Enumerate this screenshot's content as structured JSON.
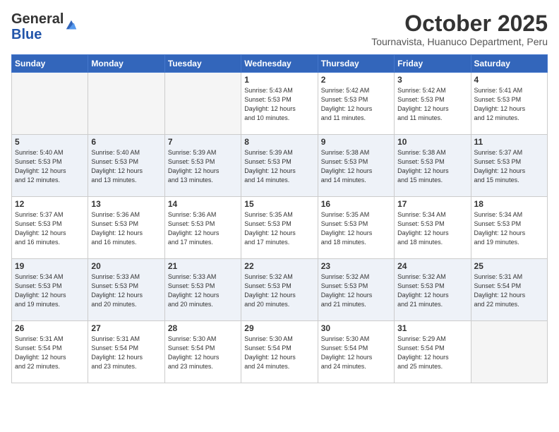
{
  "header": {
    "logo_general": "General",
    "logo_blue": "Blue",
    "month_title": "October 2025",
    "location": "Tournavista, Huanuco Department, Peru"
  },
  "days": [
    "Sunday",
    "Monday",
    "Tuesday",
    "Wednesday",
    "Thursday",
    "Friday",
    "Saturday"
  ],
  "weeks": [
    {
      "cells": [
        {
          "day": "",
          "info": ""
        },
        {
          "day": "",
          "info": ""
        },
        {
          "day": "",
          "info": ""
        },
        {
          "day": "1",
          "info": "Sunrise: 5:43 AM\nSunset: 5:53 PM\nDaylight: 12 hours\nand 10 minutes."
        },
        {
          "day": "2",
          "info": "Sunrise: 5:42 AM\nSunset: 5:53 PM\nDaylight: 12 hours\nand 11 minutes."
        },
        {
          "day": "3",
          "info": "Sunrise: 5:42 AM\nSunset: 5:53 PM\nDaylight: 12 hours\nand 11 minutes."
        },
        {
          "day": "4",
          "info": "Sunrise: 5:41 AM\nSunset: 5:53 PM\nDaylight: 12 hours\nand 12 minutes."
        }
      ]
    },
    {
      "cells": [
        {
          "day": "5",
          "info": "Sunrise: 5:40 AM\nSunset: 5:53 PM\nDaylight: 12 hours\nand 12 minutes."
        },
        {
          "day": "6",
          "info": "Sunrise: 5:40 AM\nSunset: 5:53 PM\nDaylight: 12 hours\nand 13 minutes."
        },
        {
          "day": "7",
          "info": "Sunrise: 5:39 AM\nSunset: 5:53 PM\nDaylight: 12 hours\nand 13 minutes."
        },
        {
          "day": "8",
          "info": "Sunrise: 5:39 AM\nSunset: 5:53 PM\nDaylight: 12 hours\nand 14 minutes."
        },
        {
          "day": "9",
          "info": "Sunrise: 5:38 AM\nSunset: 5:53 PM\nDaylight: 12 hours\nand 14 minutes."
        },
        {
          "day": "10",
          "info": "Sunrise: 5:38 AM\nSunset: 5:53 PM\nDaylight: 12 hours\nand 15 minutes."
        },
        {
          "day": "11",
          "info": "Sunrise: 5:37 AM\nSunset: 5:53 PM\nDaylight: 12 hours\nand 15 minutes."
        }
      ]
    },
    {
      "cells": [
        {
          "day": "12",
          "info": "Sunrise: 5:37 AM\nSunset: 5:53 PM\nDaylight: 12 hours\nand 16 minutes."
        },
        {
          "day": "13",
          "info": "Sunrise: 5:36 AM\nSunset: 5:53 PM\nDaylight: 12 hours\nand 16 minutes."
        },
        {
          "day": "14",
          "info": "Sunrise: 5:36 AM\nSunset: 5:53 PM\nDaylight: 12 hours\nand 17 minutes."
        },
        {
          "day": "15",
          "info": "Sunrise: 5:35 AM\nSunset: 5:53 PM\nDaylight: 12 hours\nand 17 minutes."
        },
        {
          "day": "16",
          "info": "Sunrise: 5:35 AM\nSunset: 5:53 PM\nDaylight: 12 hours\nand 18 minutes."
        },
        {
          "day": "17",
          "info": "Sunrise: 5:34 AM\nSunset: 5:53 PM\nDaylight: 12 hours\nand 18 minutes."
        },
        {
          "day": "18",
          "info": "Sunrise: 5:34 AM\nSunset: 5:53 PM\nDaylight: 12 hours\nand 19 minutes."
        }
      ]
    },
    {
      "cells": [
        {
          "day": "19",
          "info": "Sunrise: 5:34 AM\nSunset: 5:53 PM\nDaylight: 12 hours\nand 19 minutes."
        },
        {
          "day": "20",
          "info": "Sunrise: 5:33 AM\nSunset: 5:53 PM\nDaylight: 12 hours\nand 20 minutes."
        },
        {
          "day": "21",
          "info": "Sunrise: 5:33 AM\nSunset: 5:53 PM\nDaylight: 12 hours\nand 20 minutes."
        },
        {
          "day": "22",
          "info": "Sunrise: 5:32 AM\nSunset: 5:53 PM\nDaylight: 12 hours\nand 20 minutes."
        },
        {
          "day": "23",
          "info": "Sunrise: 5:32 AM\nSunset: 5:53 PM\nDaylight: 12 hours\nand 21 minutes."
        },
        {
          "day": "24",
          "info": "Sunrise: 5:32 AM\nSunset: 5:53 PM\nDaylight: 12 hours\nand 21 minutes."
        },
        {
          "day": "25",
          "info": "Sunrise: 5:31 AM\nSunset: 5:54 PM\nDaylight: 12 hours\nand 22 minutes."
        }
      ]
    },
    {
      "cells": [
        {
          "day": "26",
          "info": "Sunrise: 5:31 AM\nSunset: 5:54 PM\nDaylight: 12 hours\nand 22 minutes."
        },
        {
          "day": "27",
          "info": "Sunrise: 5:31 AM\nSunset: 5:54 PM\nDaylight: 12 hours\nand 23 minutes."
        },
        {
          "day": "28",
          "info": "Sunrise: 5:30 AM\nSunset: 5:54 PM\nDaylight: 12 hours\nand 23 minutes."
        },
        {
          "day": "29",
          "info": "Sunrise: 5:30 AM\nSunset: 5:54 PM\nDaylight: 12 hours\nand 24 minutes."
        },
        {
          "day": "30",
          "info": "Sunrise: 5:30 AM\nSunset: 5:54 PM\nDaylight: 12 hours\nand 24 minutes."
        },
        {
          "day": "31",
          "info": "Sunrise: 5:29 AM\nSunset: 5:54 PM\nDaylight: 12 hours\nand 25 minutes."
        },
        {
          "day": "",
          "info": ""
        }
      ]
    }
  ]
}
